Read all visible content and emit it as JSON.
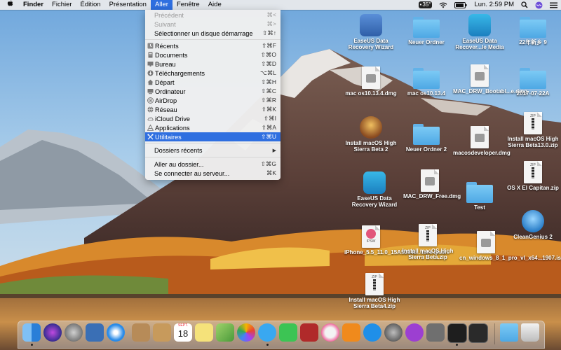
{
  "menubar": {
    "apple_icon": "apple-logo-icon",
    "items": [
      "Finder",
      "Fichier",
      "Édition",
      "Présentation",
      "Aller",
      "Fenêtre",
      "Aide"
    ],
    "active_item": "Aller",
    "status": {
      "temperature": "35°",
      "clock": "Lun. 2:59 PM"
    }
  },
  "go_menu": {
    "items": [
      {
        "label": "Précédent",
        "shortcut": "⌘<",
        "disabled": true
      },
      {
        "label": "Suivant",
        "shortcut": "⌘>",
        "disabled": true
      },
      {
        "label": "Sélectionner un disque démarrage",
        "shortcut": "⇧⌘↑"
      },
      {
        "label": "Récents",
        "shortcut": "⇧⌘F",
        "icon": "recents-icon"
      },
      {
        "label": "Documents",
        "shortcut": "⇧⌘O",
        "icon": "documents-icon"
      },
      {
        "label": "Bureau",
        "shortcut": "⇧⌘D",
        "icon": "desktop-icon"
      },
      {
        "label": "Téléchargements",
        "shortcut": "⌥⌘L",
        "icon": "downloads-icon"
      },
      {
        "label": "Départ",
        "shortcut": "⇧⌘H",
        "icon": "home-icon"
      },
      {
        "label": "Ordinateur",
        "shortcut": "⇧⌘C",
        "icon": "computer-icon"
      },
      {
        "label": "AirDrop",
        "shortcut": "⇧⌘R",
        "icon": "airdrop-icon"
      },
      {
        "label": "Réseau",
        "shortcut": "⇧⌘K",
        "icon": "network-icon"
      },
      {
        "label": "iCloud Drive",
        "shortcut": "⇧⌘I",
        "icon": "icloud-icon"
      },
      {
        "label": "Applications",
        "shortcut": "⇧⌘A",
        "icon": "applications-icon"
      },
      {
        "label": "Utilitaires",
        "shortcut": "⇧⌘U",
        "icon": "utilities-icon",
        "selected": true
      },
      {
        "label": "Dossiers récents",
        "shortcut": "▶"
      },
      {
        "label": "Aller au dossier...",
        "shortcut": "⇧⌘G"
      },
      {
        "label": "Se connecter au serveur...",
        "shortcut": "⌘K"
      }
    ]
  },
  "desktop_icons": [
    {
      "label": "EaseUS Data Recovery Wizard",
      "kind": "drive-app"
    },
    {
      "label": "Neuer Ordner",
      "kind": "folder"
    },
    {
      "label": "EaseUS Data Recover...le Media",
      "kind": "app-teal"
    },
    {
      "label": "22年新乡 9",
      "kind": "folder"
    },
    {
      "label": "mac os10.13.4.dmg",
      "kind": "doc"
    },
    {
      "label": "mac os10.13.4",
      "kind": "folder"
    },
    {
      "label": "MAC_DRW_Bootabl...e.dmg",
      "kind": "doc"
    },
    {
      "label": "2017-07-22A",
      "kind": "folder"
    },
    {
      "label": "Install macOS High Sierra Beta 2",
      "kind": "installer"
    },
    {
      "label": "Neuer Ordner 2",
      "kind": "folder"
    },
    {
      "label": "macosdeveloper.dmg",
      "kind": "doc"
    },
    {
      "label": "Install macOS High Sierra Beta13.0.zip",
      "kind": "zip"
    },
    {
      "label": "OS X El Capitan.zip",
      "kind": "zip"
    },
    {
      "label": "EaseUS Data Recovery Wizard",
      "kind": "app-teal"
    },
    {
      "label": "MAC_DRW_Free.dmg",
      "kind": "doc"
    },
    {
      "label": "Test",
      "kind": "folder"
    },
    {
      "label": "CleanGenius 2",
      "kind": "app-cg"
    },
    {
      "label": "iPhone_5.5_11.0_15A5354b...tore.ipsw",
      "kind": "ipsw"
    },
    {
      "label": "Install macOS High Sierra Beta.zip",
      "kind": "zip"
    },
    {
      "label": "cn_windows_8_1_pro_vl_x64...1907.iso",
      "kind": "doc"
    },
    {
      "label": "Install macOS High Sierra Beta4.zip",
      "kind": "zip"
    }
  ],
  "dock": {
    "apps": [
      {
        "name": "Finder",
        "icon": "finder-icon",
        "color": "#3d8fe6"
      },
      {
        "name": "Siri",
        "icon": "siri-icon",
        "color": "#6b3fd6"
      },
      {
        "name": "Launchpad",
        "icon": "launchpad-icon",
        "color": "#8c8c8c"
      },
      {
        "name": "Photo",
        "icon": "photo-icon",
        "color": "#3a6fb5"
      },
      {
        "name": "Safari",
        "icon": "safari-icon",
        "color": "#2a8be8"
      },
      {
        "name": "Notes",
        "icon": "notes-icon",
        "color": "#b78b58"
      },
      {
        "name": "Contacts",
        "icon": "contacts-icon",
        "color": "#c79a5c"
      },
      {
        "name": "Calendar",
        "icon": "calendar-icon",
        "color": "#ffffff"
      },
      {
        "name": "Stickies",
        "icon": "stickies-icon",
        "color": "#f5e27a"
      },
      {
        "name": "Maps",
        "icon": "maps-icon",
        "color": "#6dbb54"
      },
      {
        "name": "Photos",
        "icon": "photos-icon",
        "color": "#ffffff"
      },
      {
        "name": "Messages",
        "icon": "messages-icon",
        "color": "#39a8f0"
      },
      {
        "name": "FaceTime",
        "icon": "facetime-icon",
        "color": "#3cc454"
      },
      {
        "name": "Photo Booth",
        "icon": "photobooth-icon",
        "color": "#b02a2a"
      },
      {
        "name": "iTunes",
        "icon": "itunes-icon",
        "color": "#f3f3f3"
      },
      {
        "name": "iBooks",
        "icon": "ibooks-icon",
        "color": "#f08a1c"
      },
      {
        "name": "App Store",
        "icon": "appstore-icon",
        "color": "#1f8fe8"
      },
      {
        "name": "System Preferences",
        "icon": "sysprefs-icon",
        "color": "#8a8a8a"
      },
      {
        "name": "DVD",
        "icon": "dvd-icon",
        "color": "#9c3fd1"
      },
      {
        "name": "Preview",
        "icon": "preview-icon",
        "color": "#6f6f6f"
      },
      {
        "name": "Terminal",
        "icon": "terminal-icon",
        "color": "#1e1e1e"
      },
      {
        "name": "Activity Monitor",
        "icon": "activity-icon",
        "color": "#2a2a2a"
      },
      {
        "name": "Downloads",
        "icon": "downloads-stack-icon",
        "color": "#5fb0e8"
      },
      {
        "name": "Trash",
        "icon": "trash-icon",
        "color": "#dcdcdc"
      }
    ],
    "calendar_day": "18",
    "calendar_month": "SEPT."
  }
}
